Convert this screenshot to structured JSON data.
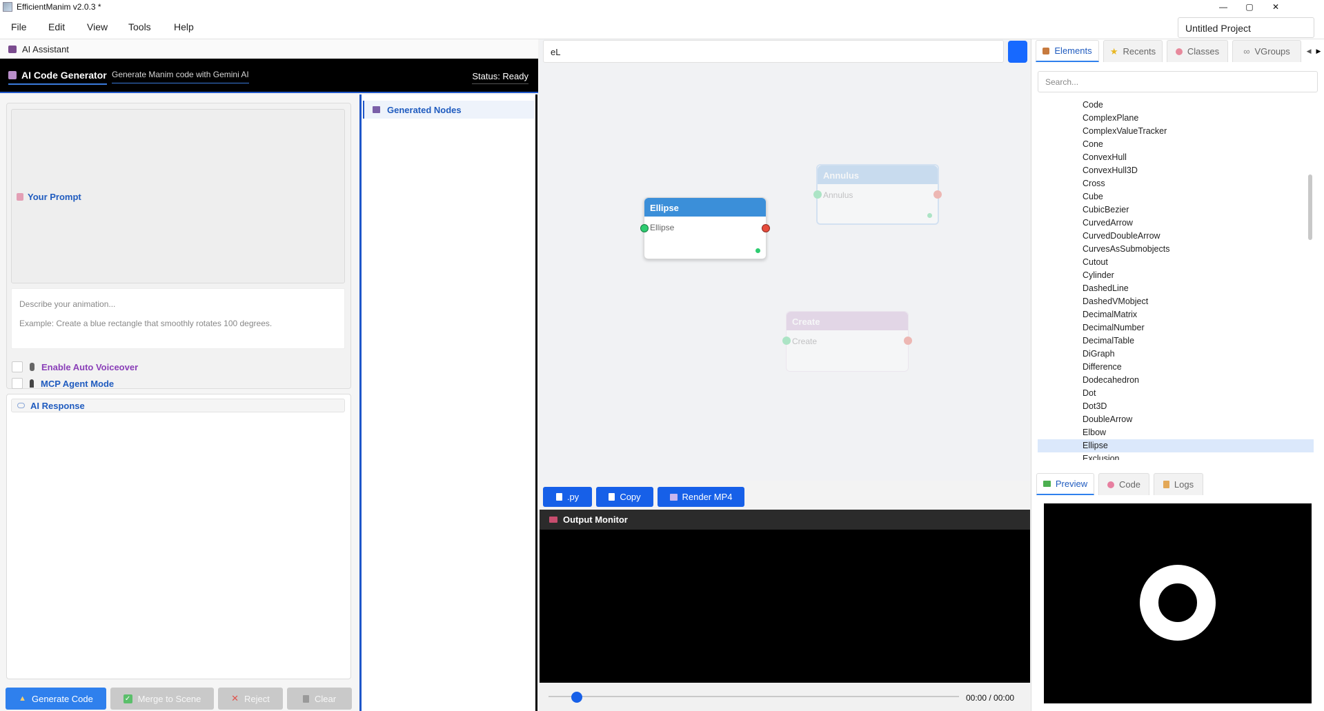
{
  "window": {
    "title": "EfficientManim v2.0.3 *",
    "controls": [
      "—",
      "▢",
      "✕"
    ]
  },
  "menu": [
    "File",
    "Edit",
    "View",
    "Tools",
    "Help"
  ],
  "project_name": "Untitled Project",
  "ai_panel": {
    "header": "AI Assistant",
    "generator_title": "AI Code Generator",
    "generator_subtitle": "Generate Manim code with Gemini AI",
    "status": "Status: Ready",
    "prompt_label": "Your Prompt",
    "prompt_placeholder_1": "Describe your animation...",
    "prompt_placeholder_2": "Example: Create a blue rectangle that smoothly rotates 100 degrees.",
    "voiceover_label": "Enable Auto Voiceover",
    "mcp_label": "MCP Agent Mode",
    "response_label": "AI Response",
    "buttons": {
      "generate": "Generate Code",
      "merge": "Merge to Scene",
      "reject": "Reject",
      "clear": "Clear"
    }
  },
  "generated_nodes": {
    "title": "Generated Nodes"
  },
  "canvas": {
    "search_value": "eL",
    "nodes": [
      {
        "title": "Ellipse",
        "label": "Ellipse",
        "color": "#3b8fd9"
      },
      {
        "title": "Annulus",
        "label": "Annulus",
        "color": "#7fb3e3"
      },
      {
        "title": "Create",
        "label": "Create",
        "color": "#c9a4cf"
      }
    ],
    "buttons": {
      "py": ".py",
      "copy": "Copy",
      "render": "Render MP4"
    }
  },
  "output_monitor": {
    "title": "Output Monitor",
    "time": "00:00 / 00:00",
    "progress": 0
  },
  "right_panel": {
    "tabs": [
      "Elements",
      "Recents",
      "Classes",
      "VGroups"
    ],
    "search_placeholder": "Search...",
    "elements": [
      "Code",
      "ComplexPlane",
      "ComplexValueTracker",
      "Cone",
      "ConvexHull",
      "ConvexHull3D",
      "Cross",
      "Cube",
      "CubicBezier",
      "CurvedArrow",
      "CurvedDoubleArrow",
      "CurvesAsSubmobjects",
      "Cutout",
      "Cylinder",
      "DashedLine",
      "DashedVMobject",
      "DecimalMatrix",
      "DecimalNumber",
      "DecimalTable",
      "DiGraph",
      "Difference",
      "Dodecahedron",
      "Dot",
      "Dot3D",
      "DoubleArrow",
      "Elbow",
      "Ellipse",
      "Exclusion"
    ],
    "selected_element": "Ellipse",
    "bottom_tabs": [
      "Preview",
      "Code",
      "Logs"
    ]
  },
  "colors": {
    "accent": "#2f80ed",
    "link": "#1f5bbf",
    "voiceover": "#8a3fb8",
    "port_in": "#2ecc71",
    "port_out": "#e74c3c"
  }
}
